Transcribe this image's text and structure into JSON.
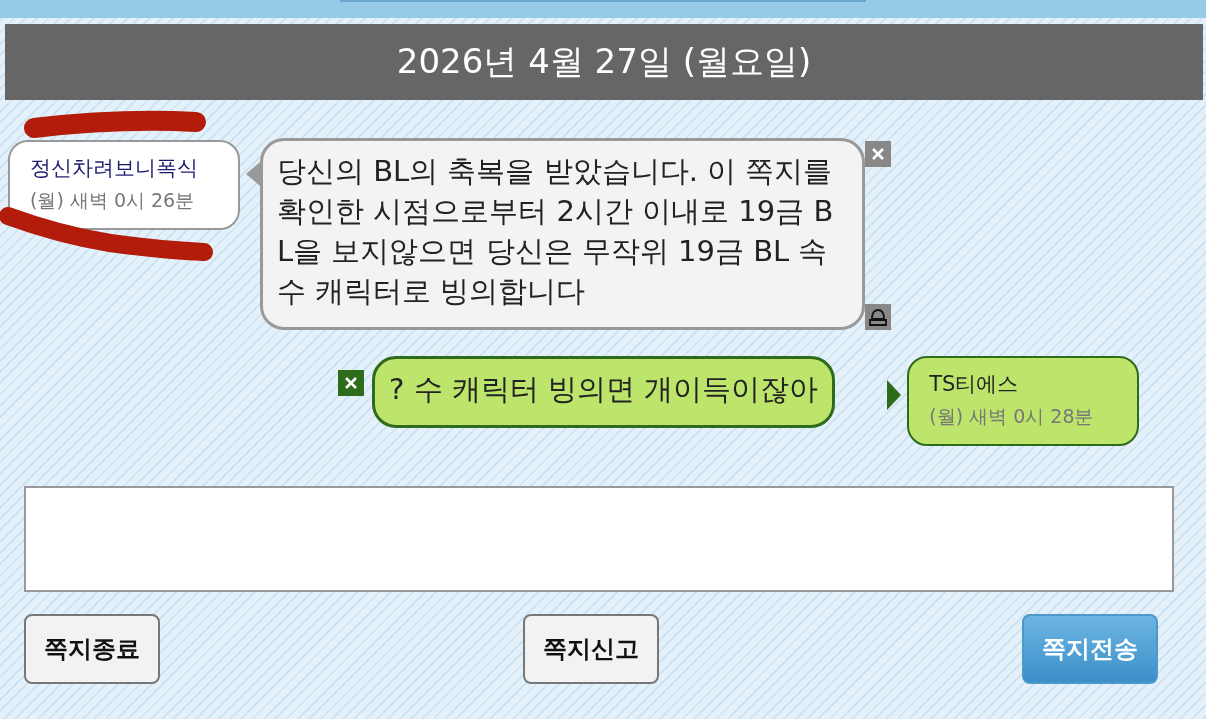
{
  "date_header": "2026년 4월 27일 (월요일)",
  "messages": [
    {
      "kind": "received",
      "sender": "정신차려보니폭식",
      "time": "(월) 새벽 0시 26분",
      "text": "당신의 BL의 축복을 받았습니다. 이 쪽지를 확인한 시점으로부터 2시간 이내로 19금 BL을 보지않으면 당신은 무작위 19금 BL 속 수 캐릭터로 빙의합니다"
    },
    {
      "kind": "sent",
      "sender": "TS티에스",
      "time": "(월) 새벽 0시 28분",
      "text": "? 수 캐릭터 빙의면 개이득이잖아"
    }
  ],
  "buttons": [
    {
      "label": "쪽지종료",
      "primary": false
    },
    {
      "label": "쪽지신고",
      "primary": false
    },
    {
      "label": "쪽지전송",
      "primary": true
    }
  ]
}
